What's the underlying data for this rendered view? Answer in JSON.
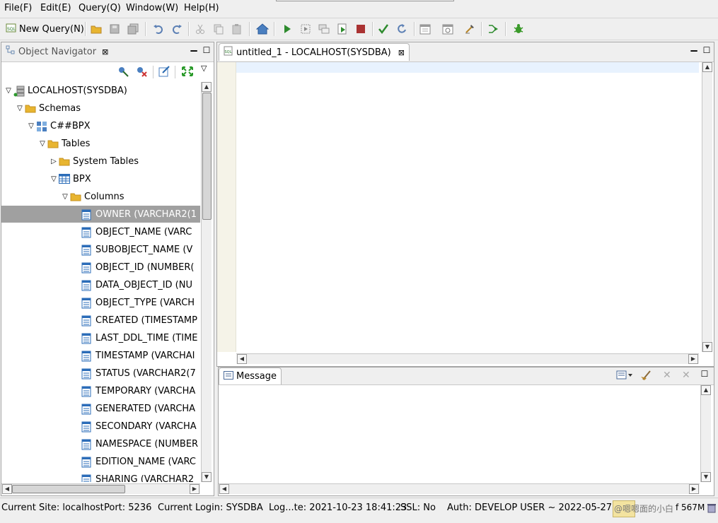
{
  "menu": [
    "File(F)",
    "Edit(E)",
    "Query(Q)",
    "Window(W)",
    "Help(H)"
  ],
  "toolbar": {
    "new_query_label": "New Query(N)",
    "icons": [
      "open-icon",
      "save-icon",
      "save-all-icon",
      "undo-icon",
      "redo-icon",
      "cut-icon",
      "copy-icon",
      "paste-icon",
      "home-icon",
      "run-icon",
      "run-selection-icon",
      "explain-icon",
      "run-script-icon",
      "stop-icon",
      "commit-icon",
      "rollback-icon",
      "calendar-icon",
      "schedule-icon",
      "format-icon",
      "step-icon",
      "debug-icon"
    ]
  },
  "navigator": {
    "title": "Object Navigator",
    "tree": [
      {
        "label": "LOCALHOST(SYSDBA)",
        "level": 0,
        "icon": "server",
        "expanded": true
      },
      {
        "label": "Schemas",
        "level": 1,
        "icon": "folder",
        "expanded": true
      },
      {
        "label": "C##BPX",
        "level": 2,
        "icon": "schema",
        "expanded": true
      },
      {
        "label": "Tables",
        "level": 3,
        "icon": "folder",
        "expanded": true
      },
      {
        "label": "System Tables",
        "level": 4,
        "icon": "folder",
        "expanded": false
      },
      {
        "label": "BPX",
        "level": 4,
        "icon": "table",
        "expanded": true
      },
      {
        "label": "Columns",
        "level": 5,
        "icon": "folder",
        "expanded": true
      },
      {
        "label": "OWNER (VARCHAR2(1",
        "level": 6,
        "icon": "column",
        "selected": true
      },
      {
        "label": "OBJECT_NAME (VARC",
        "level": 6,
        "icon": "column"
      },
      {
        "label": "SUBOBJECT_NAME (V",
        "level": 6,
        "icon": "column"
      },
      {
        "label": "OBJECT_ID (NUMBER(",
        "level": 6,
        "icon": "column"
      },
      {
        "label": "DATA_OBJECT_ID (NU",
        "level": 6,
        "icon": "column"
      },
      {
        "label": "OBJECT_TYPE (VARCH",
        "level": 6,
        "icon": "column"
      },
      {
        "label": "CREATED (TIMESTAMP",
        "level": 6,
        "icon": "column"
      },
      {
        "label": "LAST_DDL_TIME (TIME",
        "level": 6,
        "icon": "column"
      },
      {
        "label": "TIMESTAMP (VARCHAI",
        "level": 6,
        "icon": "column"
      },
      {
        "label": "STATUS (VARCHAR2(7",
        "level": 6,
        "icon": "column"
      },
      {
        "label": "TEMPORARY (VARCHA",
        "level": 6,
        "icon": "column"
      },
      {
        "label": "GENERATED (VARCHA",
        "level": 6,
        "icon": "column"
      },
      {
        "label": "SECONDARY (VARCHA",
        "level": 6,
        "icon": "column"
      },
      {
        "label": "NAMESPACE (NUMBER",
        "level": 6,
        "icon": "column"
      },
      {
        "label": "EDITION_NAME (VARC",
        "level": 6,
        "icon": "column"
      },
      {
        "label": "SHARING (VARCHAR2",
        "level": 6,
        "icon": "column"
      }
    ]
  },
  "editor": {
    "tab_title": "untitled_1 - LOCALHOST(SYSDBA)"
  },
  "message": {
    "tab_title": "Message"
  },
  "status": {
    "site": "Current Site: localhost",
    "port": "Port: 5236",
    "login": "Current Login: SYSDBA",
    "logtime": "Log...te: 2021-10-23 18:41:23",
    "ssl": "SSL: No",
    "auth": "Auth: DEVELOP USER ~ 2022-05-27",
    "memory": "@嗯嗯面的小白",
    "memory_suffix": "f 567M"
  },
  "colors": {
    "accent_green": "#3a9a2a",
    "folder": "#e8b530",
    "column_icon": "#2b6cb8",
    "selection": "#a0a0a0"
  }
}
